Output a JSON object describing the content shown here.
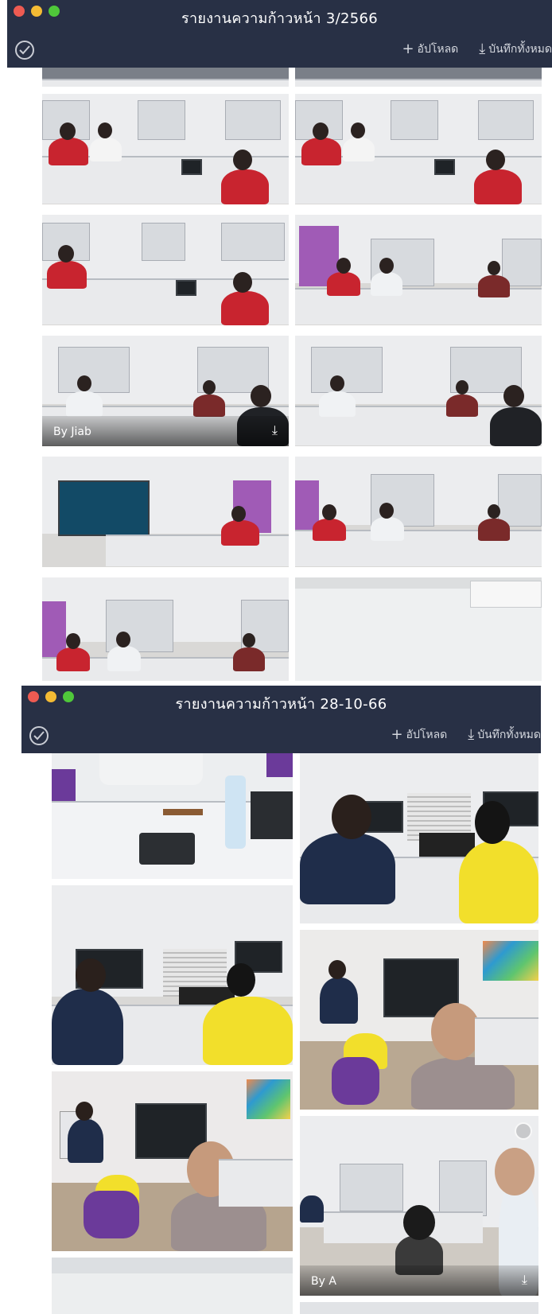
{
  "albums": [
    {
      "title": "รายงานความก้าวหน้า 3/2566",
      "upload_label": "อัปโหลด",
      "save_all_label": "บันทึกทั้งหมด",
      "traffic_colors": [
        "#ee5b52",
        "#f4bb34",
        "#4fc83a"
      ],
      "photo_overlay": {
        "author": "By Jiab"
      }
    },
    {
      "title": "รายงานความก้าวหน้า 28-10-66",
      "upload_label": "อัปโหลด",
      "save_all_label": "บันทึกทั้งหมด",
      "traffic_colors": [
        "#ee5b52",
        "#f4bb34",
        "#4fc83a"
      ],
      "photo_overlay": {
        "author": "By A"
      }
    }
  ],
  "icons": {
    "plus": "plus-icon",
    "download": "download-icon",
    "check": "check-circle-icon"
  },
  "colors": {
    "titlebar": "#283045",
    "shirt_red": "#c8242f",
    "shirt_yellow": "#f2df2b",
    "shirt_navy": "#1f2d4a",
    "chair_purple": "#6b3a9a"
  }
}
